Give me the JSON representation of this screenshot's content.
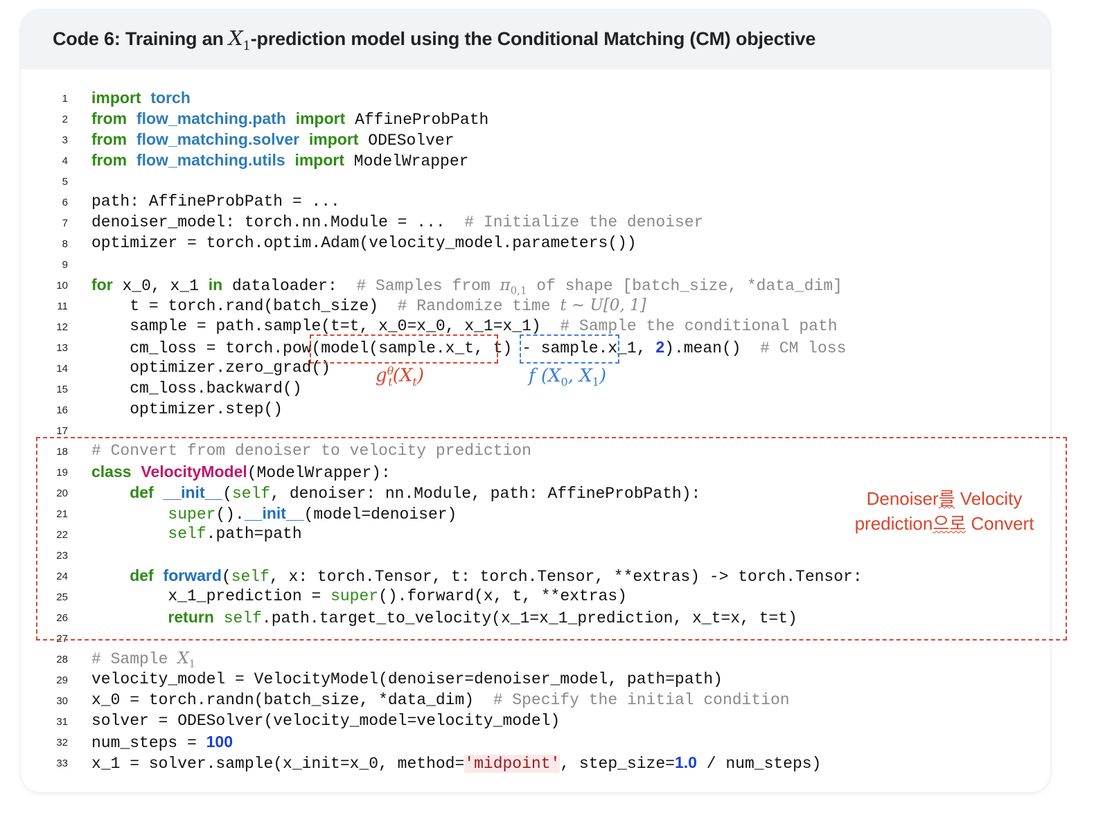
{
  "title": {
    "prefix": "Code 6: Training an ",
    "math_var": "X",
    "math_sub": "1",
    "suffix": "-prediction model using the Conditional Matching (CM) objective"
  },
  "lines": [
    {
      "n": "1",
      "tokens": [
        {
          "t": "import",
          "c": "kw"
        },
        {
          "t": " "
        },
        {
          "t": "torch",
          "c": "mod"
        }
      ]
    },
    {
      "n": "2",
      "tokens": [
        {
          "t": "from",
          "c": "kw"
        },
        {
          "t": " "
        },
        {
          "t": "flow_matching.path",
          "c": "mod"
        },
        {
          "t": " "
        },
        {
          "t": "import",
          "c": "kw"
        },
        {
          "t": " AffineProbPath"
        }
      ]
    },
    {
      "n": "3",
      "tokens": [
        {
          "t": "from",
          "c": "kw"
        },
        {
          "t": " "
        },
        {
          "t": "flow_matching.solver",
          "c": "mod"
        },
        {
          "t": " "
        },
        {
          "t": "import",
          "c": "kw"
        },
        {
          "t": " ODESolver"
        }
      ]
    },
    {
      "n": "4",
      "tokens": [
        {
          "t": "from",
          "c": "kw"
        },
        {
          "t": " "
        },
        {
          "t": "flow_matching.utils",
          "c": "mod"
        },
        {
          "t": " "
        },
        {
          "t": "import",
          "c": "kw"
        },
        {
          "t": " ModelWrapper"
        }
      ]
    },
    {
      "n": "5",
      "tokens": []
    },
    {
      "n": "6",
      "tokens": [
        {
          "t": "path: AffineProbPath = ..."
        }
      ]
    },
    {
      "n": "7",
      "tokens": [
        {
          "t": "denoiser_model: torch.nn.Module = ...  "
        },
        {
          "t": "# Initialize the denoiser",
          "c": "com"
        }
      ]
    },
    {
      "n": "8",
      "tokens": [
        {
          "t": "optimizer = torch.optim.Adam(velocity_model.parameters())"
        }
      ]
    },
    {
      "n": "9",
      "tokens": []
    },
    {
      "n": "10",
      "tokens": [
        {
          "t": "for",
          "c": "kw"
        },
        {
          "t": " x_0, x_1 "
        },
        {
          "t": "in",
          "c": "kw"
        },
        {
          "t": " dataloader:  "
        },
        {
          "t": "# Samples from ",
          "c": "com"
        },
        {
          "t": "π",
          "c": "math",
          "sub": "0,1"
        },
        {
          "t": " of shape [batch_size, *data_dim]",
          "c": "com"
        }
      ]
    },
    {
      "n": "11",
      "tokens": [
        {
          "t": "    t = torch.rand(batch_size)  "
        },
        {
          "t": "# Randomize time ",
          "c": "com"
        },
        {
          "t": "t ~ U[0, 1]",
          "c": "math"
        }
      ]
    },
    {
      "n": "12",
      "tokens": [
        {
          "t": "    sample = path.sample(t=t, x_0=x_0, x_1=x_1)  "
        },
        {
          "t": "# Sample the conditional path",
          "c": "com"
        }
      ]
    },
    {
      "n": "13",
      "tokens": [
        {
          "t": "    cm_loss = torch.pow(model(sample.x_t, t) - sample.x_1, "
        },
        {
          "t": "2",
          "c": "num"
        },
        {
          "t": ").mean()  "
        },
        {
          "t": "# CM loss",
          "c": "com"
        }
      ]
    },
    {
      "n": "14",
      "tokens": [
        {
          "t": "    optimizer.zero_grad()"
        }
      ]
    },
    {
      "n": "15",
      "tokens": [
        {
          "t": "    cm_loss.backward()"
        }
      ]
    },
    {
      "n": "16",
      "tokens": [
        {
          "t": "    optimizer.step()"
        }
      ]
    },
    {
      "n": "17",
      "tokens": []
    },
    {
      "n": "18",
      "tokens": [
        {
          "t": "# Convert from denoiser to velocity prediction",
          "c": "com"
        }
      ]
    },
    {
      "n": "19",
      "tokens": [
        {
          "t": "class",
          "c": "kw"
        },
        {
          "t": " "
        },
        {
          "t": "VelocityModel",
          "c": "cls"
        },
        {
          "t": "(ModelWrapper):"
        }
      ]
    },
    {
      "n": "20",
      "tokens": [
        {
          "t": "    "
        },
        {
          "t": "def",
          "c": "kw"
        },
        {
          "t": " "
        },
        {
          "t": "__init__",
          "c": "fn"
        },
        {
          "t": "("
        },
        {
          "t": "self",
          "c": "self"
        },
        {
          "t": ", denoiser: nn.Module, path: AffineProbPath):"
        }
      ]
    },
    {
      "n": "21",
      "tokens": [
        {
          "t": "        "
        },
        {
          "t": "super",
          "c": "self"
        },
        {
          "t": "()."
        },
        {
          "t": "__init__",
          "c": "fn"
        },
        {
          "t": "(model=denoiser)"
        }
      ]
    },
    {
      "n": "22",
      "tokens": [
        {
          "t": "        "
        },
        {
          "t": "self",
          "c": "self"
        },
        {
          "t": ".path=path"
        }
      ]
    },
    {
      "n": "23",
      "tokens": []
    },
    {
      "n": "24",
      "tokens": [
        {
          "t": "    "
        },
        {
          "t": "def",
          "c": "kw"
        },
        {
          "t": " "
        },
        {
          "t": "forward",
          "c": "fn"
        },
        {
          "t": "("
        },
        {
          "t": "self",
          "c": "self"
        },
        {
          "t": ", x: torch.Tensor, t: torch.Tensor, **extras) -> torch.Tensor:"
        }
      ]
    },
    {
      "n": "25",
      "tokens": [
        {
          "t": "        x_1_prediction = "
        },
        {
          "t": "super",
          "c": "self"
        },
        {
          "t": "().forward(x, t, **extras)"
        }
      ]
    },
    {
      "n": "26",
      "tokens": [
        {
          "t": "        "
        },
        {
          "t": "return",
          "c": "kw"
        },
        {
          "t": " "
        },
        {
          "t": "self",
          "c": "self"
        },
        {
          "t": ".path.target_to_velocity(x_1=x_1_prediction, x_t=x, t=t)"
        }
      ]
    },
    {
      "n": "27",
      "tokens": []
    },
    {
      "n": "28",
      "tokens": [
        {
          "t": "# Sample ",
          "c": "com"
        },
        {
          "t": "X",
          "c": "math",
          "sub": "1"
        }
      ]
    },
    {
      "n": "29",
      "tokens": [
        {
          "t": "velocity_model = VelocityModel(denoiser=denoiser_model, path=path)"
        }
      ]
    },
    {
      "n": "30",
      "tokens": [
        {
          "t": "x_0 = torch.randn(batch_size, *data_dim)  "
        },
        {
          "t": "# Specify the initial condition",
          "c": "com"
        }
      ]
    },
    {
      "n": "31",
      "tokens": [
        {
          "t": "solver = ODESolver(velocity_model=velocity_model)"
        }
      ]
    },
    {
      "n": "32",
      "tokens": [
        {
          "t": "num_steps = "
        },
        {
          "t": "100",
          "c": "num"
        }
      ]
    },
    {
      "n": "33",
      "tokens": [
        {
          "t": "x_1 = solver.sample(x_init=x_0, method="
        },
        {
          "t": "'midpoint'",
          "c": "str"
        },
        {
          "t": ", step_size="
        },
        {
          "t": "1.0",
          "c": "num"
        },
        {
          "t": " / num_steps)"
        }
      ]
    }
  ],
  "labels": {
    "red": {
      "base": "g",
      "sup": "θ",
      "sub": "t",
      "arg": "(X",
      "arg_sub": "t",
      "close": ")"
    },
    "blue": {
      "text": "f (X",
      "s0": "0",
      "mid": ", X",
      "s1": "1",
      "close": ")"
    }
  },
  "annotation": {
    "line1_a": "Denoiser",
    "line1_b": "를",
    "line1_c": " Velocity",
    "line2_a": "prediction",
    "line2_b": "으로",
    "line2_c": " Convert"
  },
  "colors": {
    "keyword": "#2f8a16",
    "module": "#2f7cb8",
    "comment": "#8a8a8a",
    "class_name": "#c0186b",
    "function": "#1f6fbf",
    "number": "#1a3fd6",
    "string": "#9b1b1b",
    "annotation_red": "#d9452b",
    "annotation_blue": "#3a7fd6"
  }
}
